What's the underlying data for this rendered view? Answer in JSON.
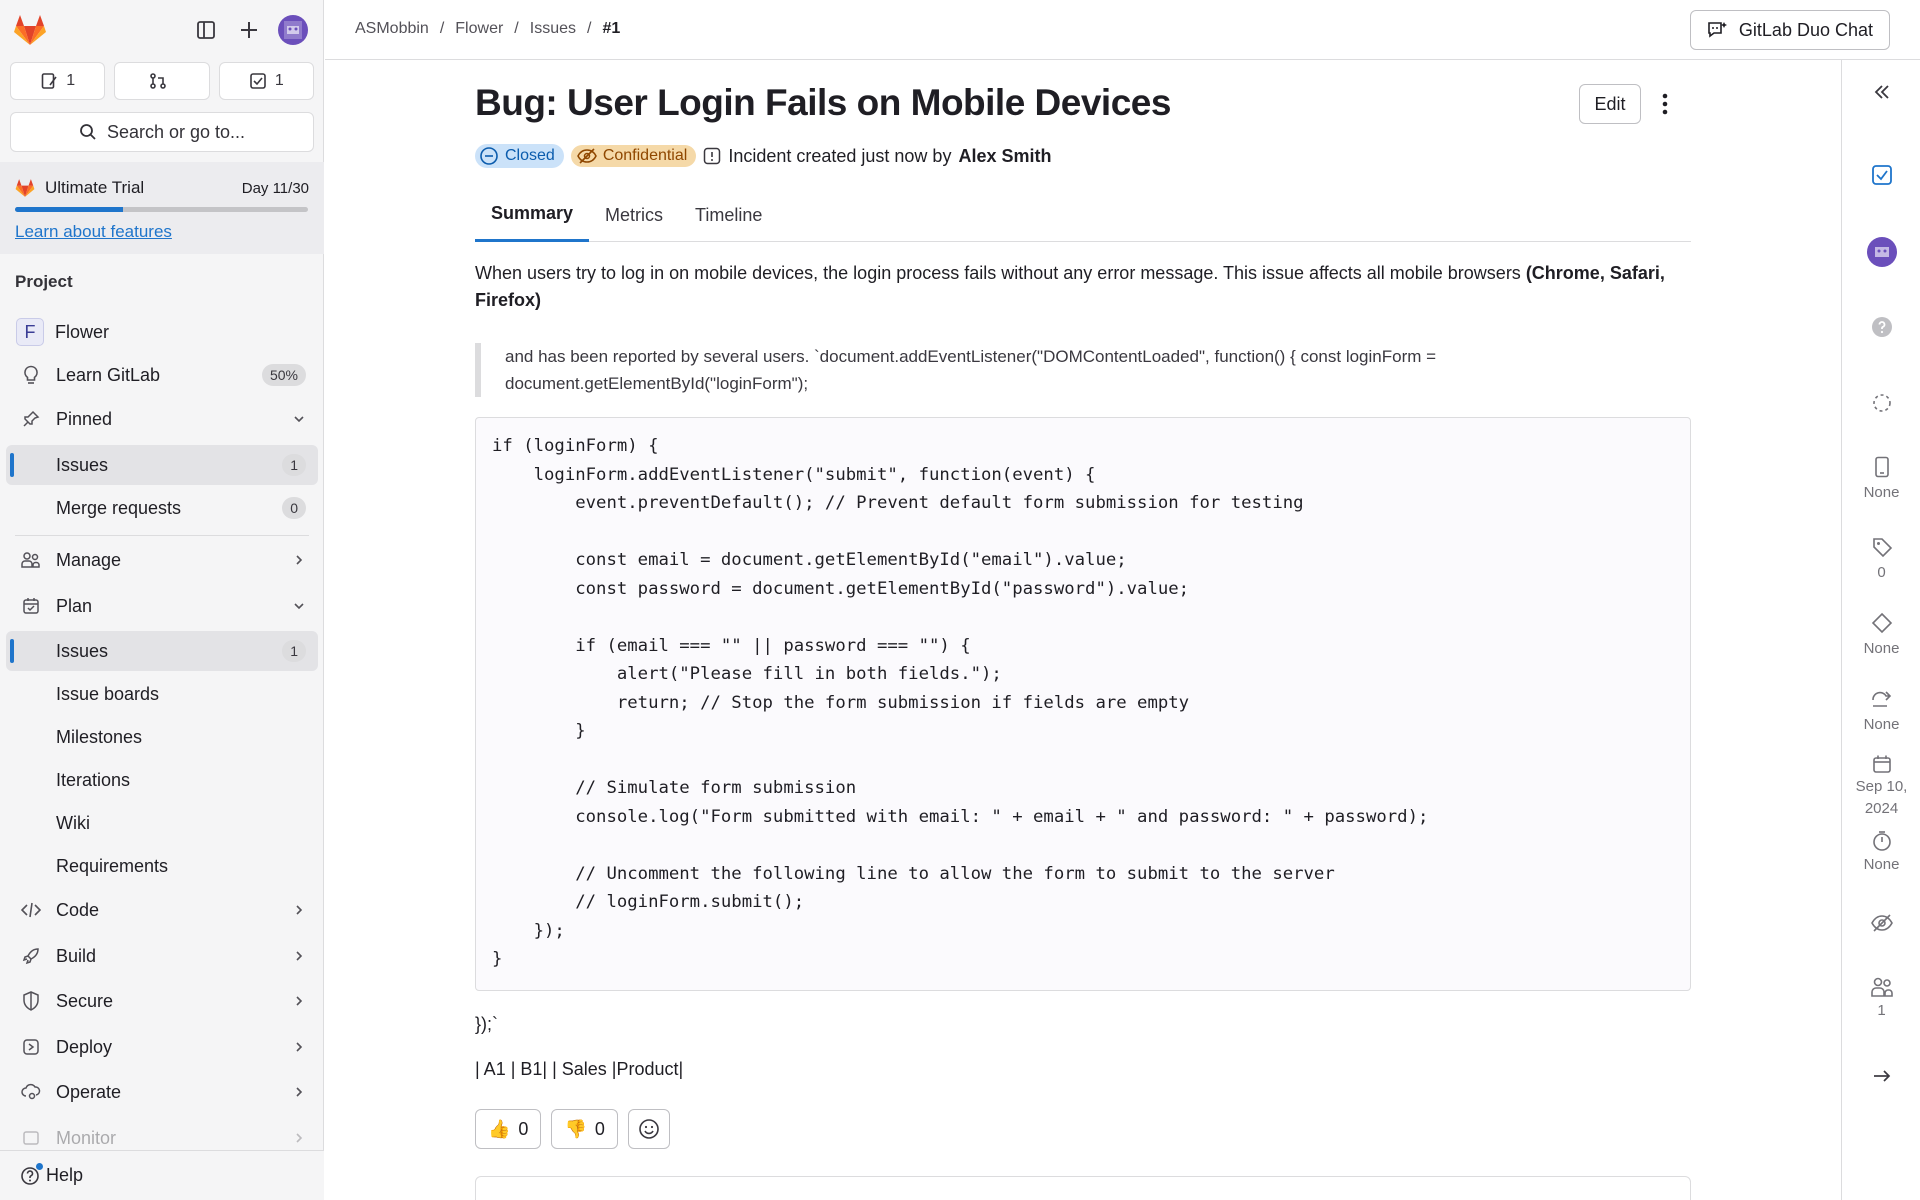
{
  "sidebar": {
    "counts": {
      "issues": "1",
      "merge_requests": "",
      "todos": "1"
    },
    "search_label": "Search or go to...",
    "trial": {
      "label": "Ultimate Trial",
      "day": "Day 11/30",
      "progress_fraction": 0.37,
      "link": "Learn about features"
    },
    "section_label": "Project",
    "project": {
      "avatar_letter": "F",
      "name": "Flower"
    },
    "learn": {
      "label": "Learn GitLab",
      "badge": "50%"
    },
    "pinned": {
      "label": "Pinned",
      "items": [
        {
          "label": "Issues",
          "count": "1"
        },
        {
          "label": "Merge requests",
          "count": "0"
        }
      ]
    },
    "manage": "Manage",
    "plan": {
      "label": "Plan",
      "items": [
        {
          "label": "Issues",
          "count": "1"
        },
        {
          "label": "Issue boards"
        },
        {
          "label": "Milestones"
        },
        {
          "label": "Iterations"
        },
        {
          "label": "Wiki"
        },
        {
          "label": "Requirements"
        }
      ]
    },
    "code": "Code",
    "build": "Build",
    "secure": "Secure",
    "deploy": "Deploy",
    "operate": "Operate",
    "monitor": "Monitor",
    "help": "Help"
  },
  "breadcrumb": [
    "ASMobbin",
    "Flower",
    "Issues",
    "#1"
  ],
  "duo_chat": "GitLab Duo Chat",
  "issue": {
    "title": "Bug: User Login Fails on Mobile Devices",
    "edit_label": "Edit",
    "status": "Closed",
    "confidential": "Confidential",
    "meta_text": "Incident created just now by",
    "author": "Alex Smith",
    "tabs": [
      "Summary",
      "Metrics",
      "Timeline"
    ],
    "description": "When users try to log in on mobile devices, the login process fails without any error message. This issue affects all mobile browsers ",
    "description_bold": "(Chrome, Safari, Firefox)",
    "quote": "and has been reported by several users. `document.addEventListener(\"DOMContentLoaded\", function() { const loginForm = document.getElementById(\"loginForm\");",
    "code": "if (loginForm) {\n    loginForm.addEventListener(\"submit\", function(event) {\n        event.preventDefault(); // Prevent default form submission for testing\n\n        const email = document.getElementById(\"email\").value;\n        const password = document.getElementById(\"password\").value;\n\n        if (email === \"\" || password === \"\") {\n            alert(\"Please fill in both fields.\");\n            return; // Stop the form submission if fields are empty\n        }\n\n        // Simulate form submission\n        console.log(\"Form submitted with email: \" + email + \" and password: \" + password);\n\n        // Uncomment the following line to allow the form to submit to the server\n        // loginForm.submit();\n    });\n}",
    "after_code": "});`",
    "table_line": "| A1 | B1| | Sales |Product|",
    "thumbs_up": "0",
    "thumbs_down": "0"
  },
  "rail": {
    "health": "None",
    "labels": "0",
    "milestone": "None",
    "iteration": "None",
    "date": "Sep 10, 2024",
    "time": "None",
    "participants": "1"
  },
  "colors": {
    "accent": "#1f75cb",
    "closed_bg": "#cbe2f9",
    "confidential_bg": "#f5d9a8",
    "avatar_purple": "#6b4fbb"
  }
}
